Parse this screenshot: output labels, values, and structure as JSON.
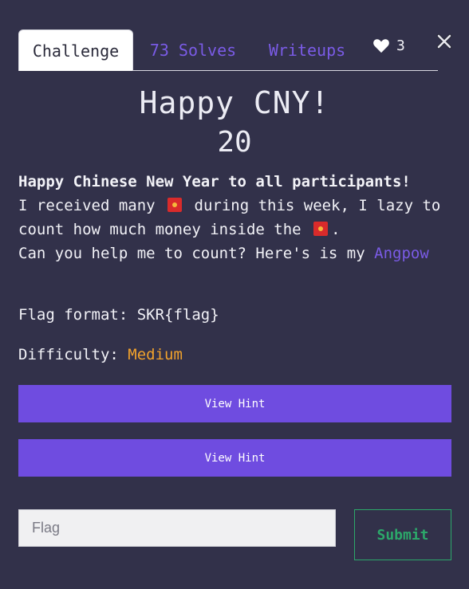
{
  "tabs": {
    "challenge": "Challenge",
    "solves": "73 Solves",
    "writeups": "Writeups"
  },
  "likes": {
    "icon": "heart-icon",
    "count": "3"
  },
  "close": {
    "icon": "close-icon",
    "symbol": "✕"
  },
  "challenge": {
    "name": "Happy CNY!",
    "points": "20"
  },
  "description": {
    "line1": "Happy Chinese New Year to all participants!",
    "line2_a": "I received many",
    "line2_b": "during this week, I lazy to count how much money inside the",
    "line2_c": ".",
    "emoji_icon": "red-envelope-icon",
    "line3": "Can you help me to count? Here's is my",
    "link_text": "Angpow"
  },
  "flag_format": "Flag format: SKR{flag}",
  "difficulty": {
    "label": "Difficulty:",
    "level": "Medium",
    "level_color": "#f1a22c"
  },
  "hints": [
    {
      "label": "View Hint"
    },
    {
      "label": "View Hint"
    }
  ],
  "flag_input": {
    "placeholder": "Flag",
    "value": ""
  },
  "submit_label": "Submit",
  "colors": {
    "background": "#32314a",
    "accent": "#6f4ce0",
    "link": "#7a5be6",
    "submit": "#2ca86a"
  }
}
